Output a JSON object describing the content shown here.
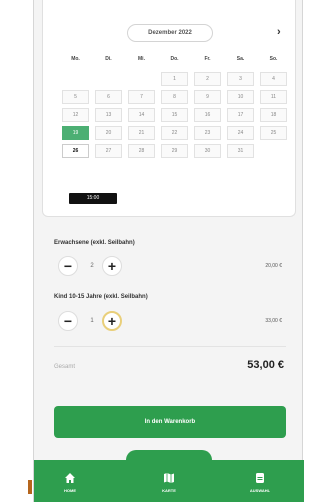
{
  "calendar": {
    "month": "Dezember 2022",
    "next_icon": "chevron-right-icon",
    "weekdays": [
      "Mo.",
      "Di.",
      "Mi.",
      "Do.",
      "Fr.",
      "Sa.",
      "So."
    ],
    "rows": [
      [
        "",
        "",
        "",
        "1",
        "2",
        "3",
        "4"
      ],
      [
        "5",
        "6",
        "7",
        "8",
        "9",
        "10",
        "11"
      ],
      [
        "12",
        "13",
        "14",
        "15",
        "16",
        "17",
        "18"
      ],
      [
        "19",
        "20",
        "21",
        "22",
        "23",
        "24",
        "25"
      ],
      [
        "26",
        "27",
        "28",
        "29",
        "30",
        "31",
        ""
      ]
    ]
  },
  "time_slot": "15:00",
  "tickets": [
    {
      "label": "Erwachsene (exkl. Seilbahn)",
      "qty": "2",
      "price": "20,00 €"
    },
    {
      "label": "Kind 10-15 Jahre (exkl. Seilbahn)",
      "qty": "1",
      "price": "33,00 €"
    }
  ],
  "total": {
    "label": "Gesamt",
    "value": "53,00 €"
  },
  "cart_button": "In den Warenkorb",
  "nav": [
    {
      "label": "HOME",
      "icon": "home-icon"
    },
    {
      "label": "KARTE",
      "icon": "map-icon"
    },
    {
      "label": "AUSWAHL",
      "icon": "ticket-icon"
    }
  ],
  "colors": {
    "accent": "#2e9e4e",
    "selected_day": "#4caf73",
    "highlight": "#e9cf7a"
  }
}
